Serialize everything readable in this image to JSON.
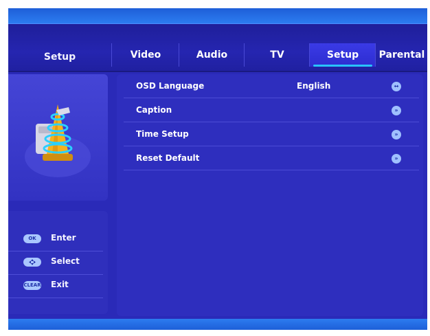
{
  "tabs": {
    "section_title": "Setup",
    "items": [
      {
        "label": "Video"
      },
      {
        "label": "Audio"
      },
      {
        "label": "TV"
      },
      {
        "label": "Setup"
      },
      {
        "label": "Parental"
      }
    ],
    "active": "Setup"
  },
  "menu": {
    "rows": [
      {
        "label": "OSD Language",
        "value": "English",
        "button_icon": "left-right-icon"
      },
      {
        "label": "Caption",
        "value": "",
        "button_icon": "forward-icon"
      },
      {
        "label": "Time Setup",
        "value": "",
        "button_icon": "forward-icon"
      },
      {
        "label": "Reset Default",
        "value": "",
        "button_icon": "forward-icon"
      }
    ]
  },
  "legend": {
    "items": [
      {
        "key": "OK",
        "label": "Enter"
      },
      {
        "key": "",
        "label": "Select"
      },
      {
        "key": "CLEAR",
        "label": "Exit"
      }
    ]
  },
  "icons": {
    "setup_illustration": "setup-tools-icon"
  },
  "colors": {
    "background": "#2a2ab8",
    "accent": "#29c3ff",
    "frame": "#2c7cf0"
  }
}
